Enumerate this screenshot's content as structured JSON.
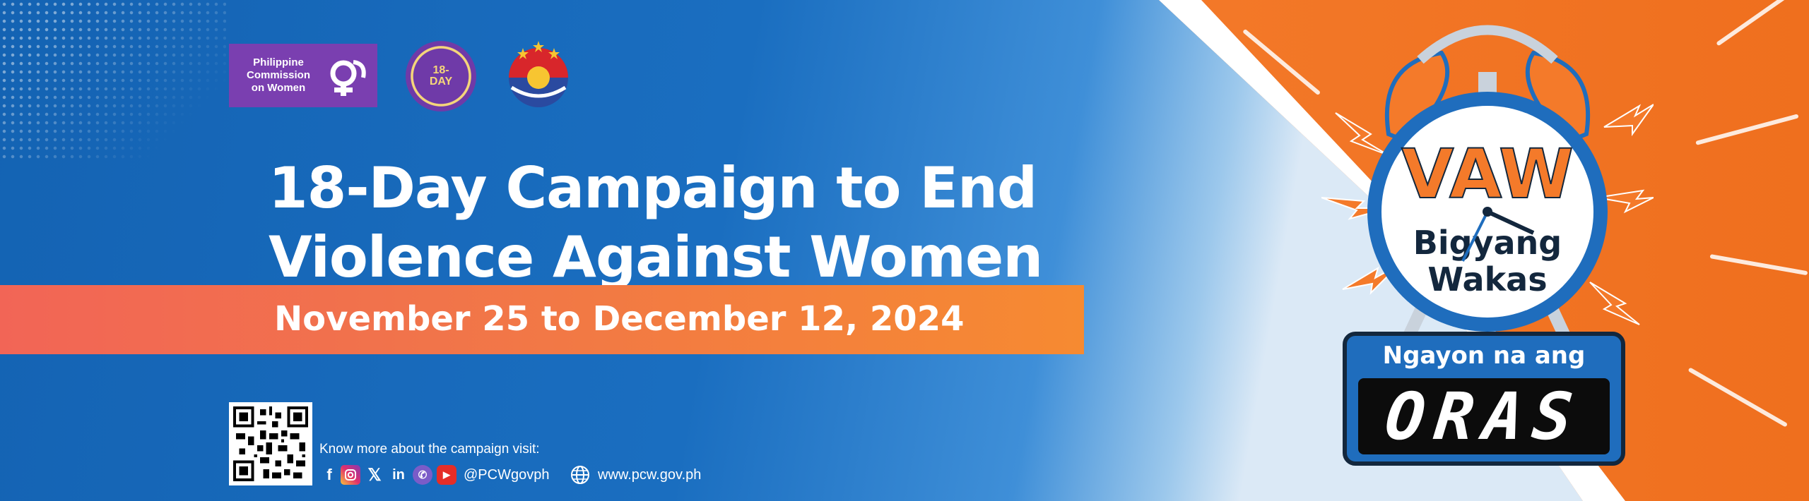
{
  "logos": {
    "pcw_text": "Philippine\nCommission\non Women",
    "seal_18_text": "18-\nDAY",
    "pcw_icon": "pcw-female-symbol-icon",
    "ph_seal_icon": "philippine-sun-seal-icon"
  },
  "headline": {
    "line1": "18-Day Campaign to End",
    "line2": "Violence Against Women"
  },
  "dates": "November 25 to December 12, 2024",
  "footer": {
    "know_more": "Know more about the campaign visit:",
    "social_icons": [
      "facebook-icon",
      "instagram-icon",
      "x-icon",
      "linkedin-icon",
      "viber-icon",
      "youtube-icon"
    ],
    "handle": "@PCWgovph",
    "website": "www.pcw.gov.ph"
  },
  "clock": {
    "top_text": "VAW",
    "mid_line1": "Bigyang",
    "mid_line2": "Wakas",
    "lcd_title": "Ngayon na ang",
    "lcd_display": "ORAS"
  },
  "colors": {
    "blue": "#1a6ec0",
    "orange": "#f47a2a",
    "purple": "#7a3fb0",
    "band": "#f26556"
  }
}
